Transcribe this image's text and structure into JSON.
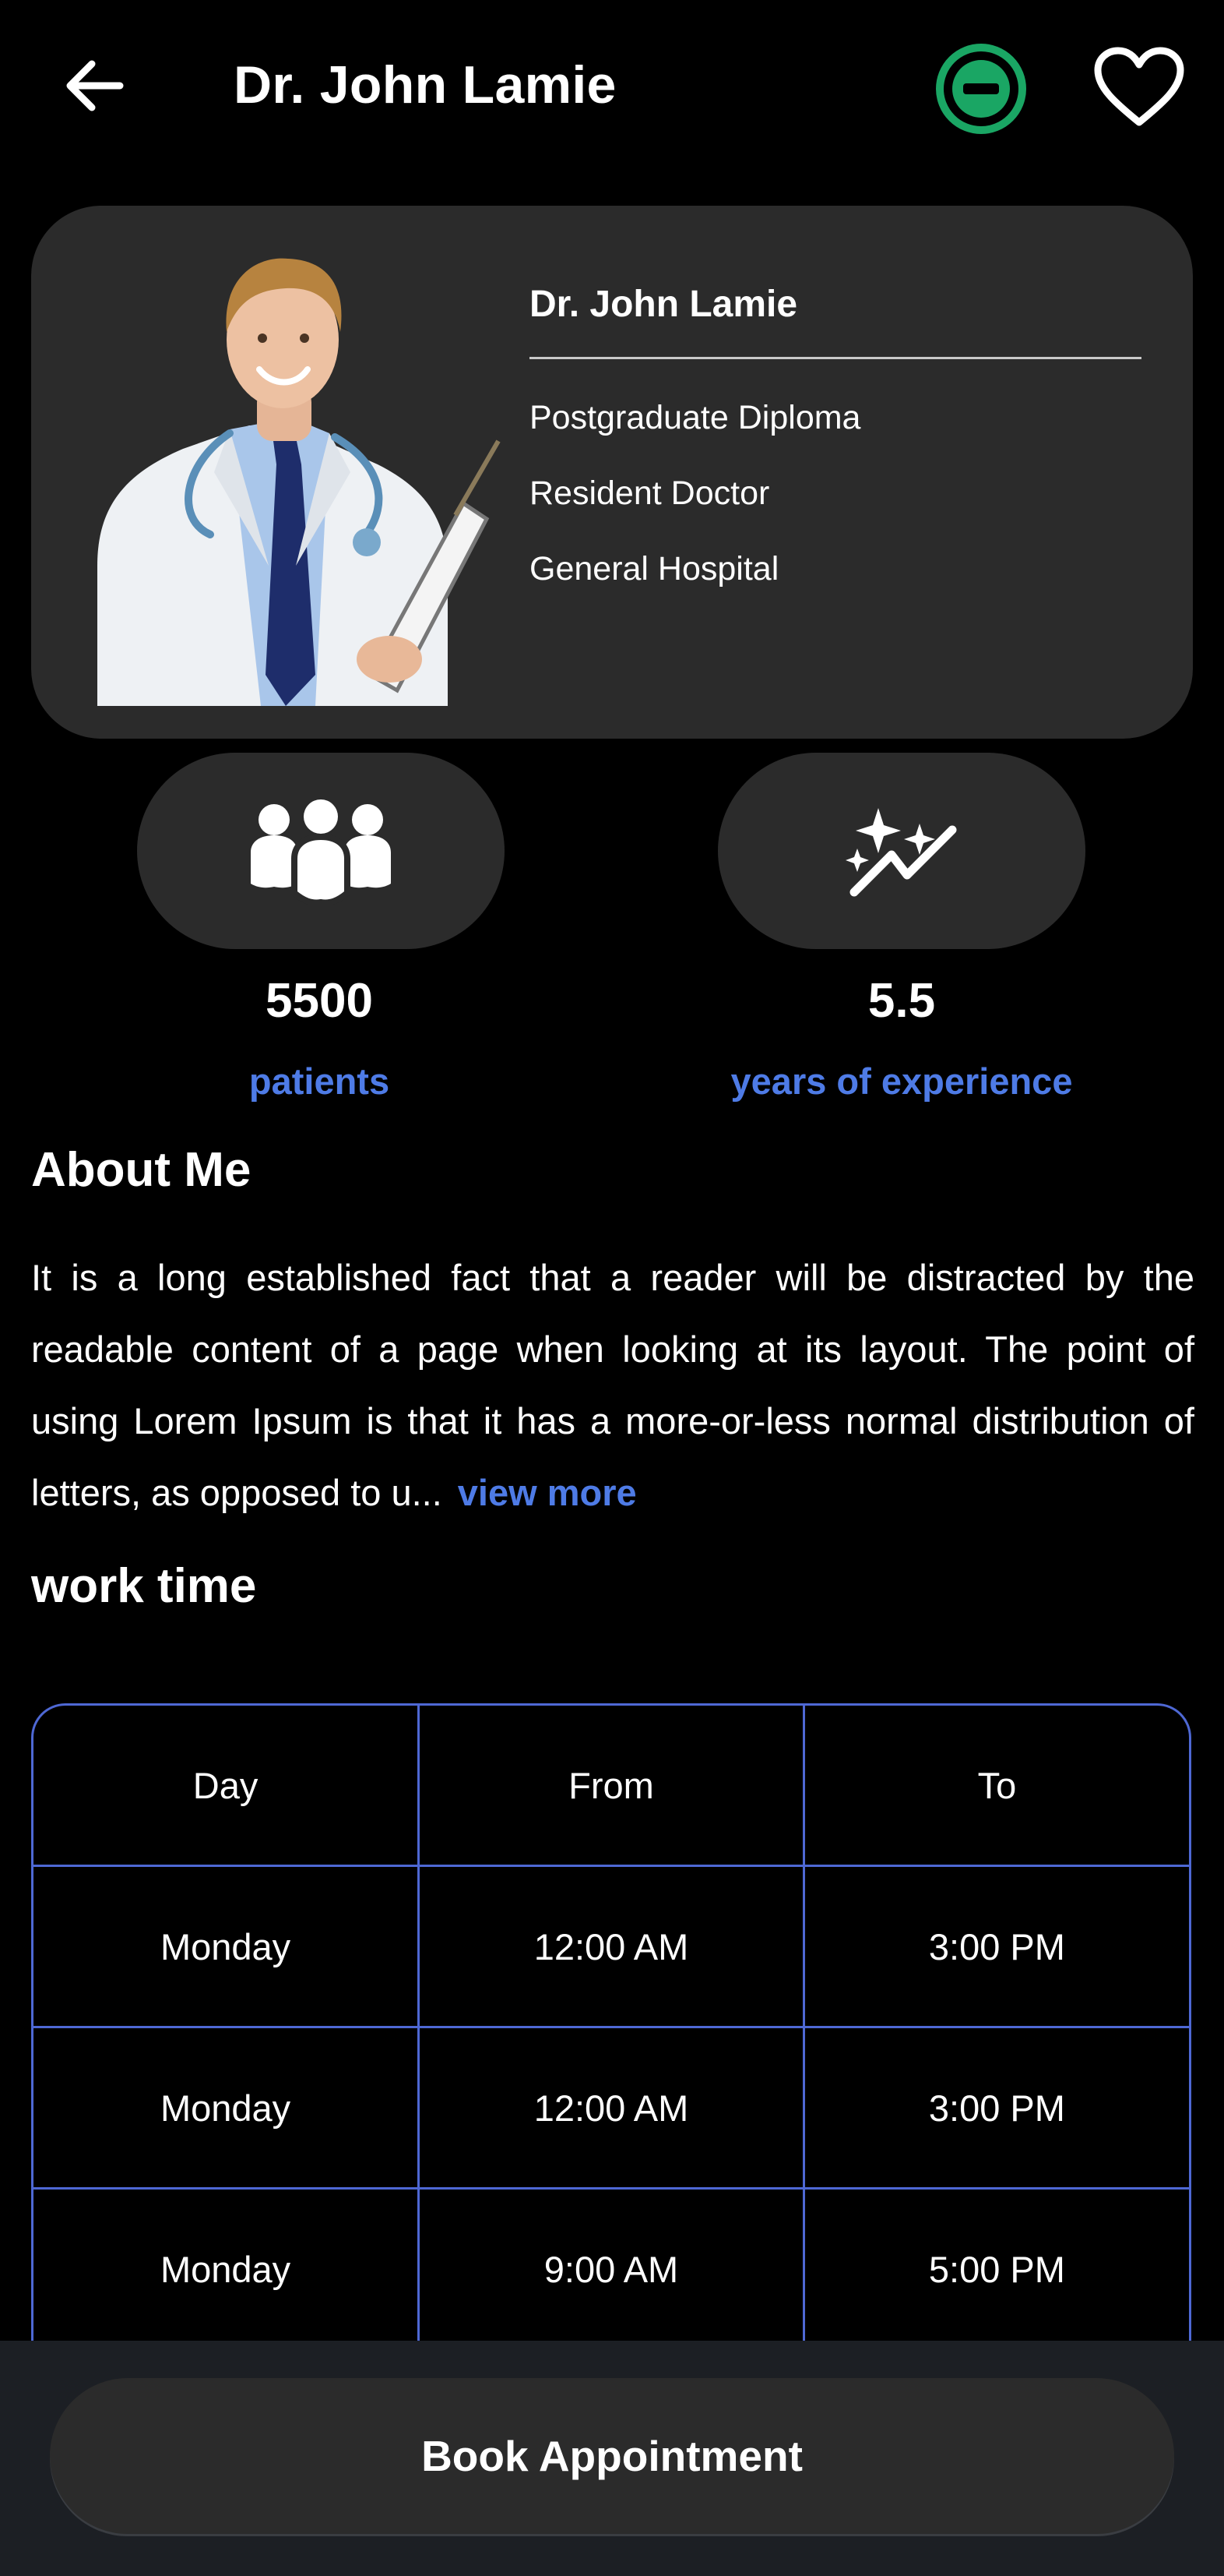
{
  "header": {
    "title": "Dr. John Lamie",
    "back_icon": "arrow-left-icon",
    "status_icon": "minus-circle-icon",
    "favorite_icon": "heart-outline-icon"
  },
  "profile": {
    "name": "Dr. John Lamie",
    "lines": [
      "Postgraduate Diploma",
      "Resident Doctor",
      "General Hospital"
    ]
  },
  "stats": [
    {
      "icon": "patients-group-icon",
      "value": "5500",
      "label": "patients"
    },
    {
      "icon": "sparkle-trend-icon",
      "value": "5.5",
      "label": "years of experience"
    }
  ],
  "about": {
    "title": "About Me",
    "text": "It is a long established fact that a reader will be distracted by the readable content of a page when looking at its layout. The point of using Lorem Ipsum is that it has a more-or-less normal distribution of letters, as opposed to u...",
    "view_more": "view more"
  },
  "work_time": {
    "title": "work time",
    "headers": [
      "Day",
      "From",
      "To"
    ],
    "rows": [
      [
        "Monday",
        "12:00 AM",
        "3:00 PM"
      ],
      [
        "Monday",
        "12:00 AM",
        "3:00 PM"
      ],
      [
        "Monday",
        "9:00 AM",
        "5:00 PM"
      ],
      [
        "",
        "",
        ""
      ]
    ]
  },
  "book_button": "Book Appointment",
  "colors": {
    "background": "#000000",
    "card": "#2b2b2b",
    "accent_blue": "#4e7be6",
    "status_green": "#1aa664",
    "table_border": "#4e68d4"
  }
}
